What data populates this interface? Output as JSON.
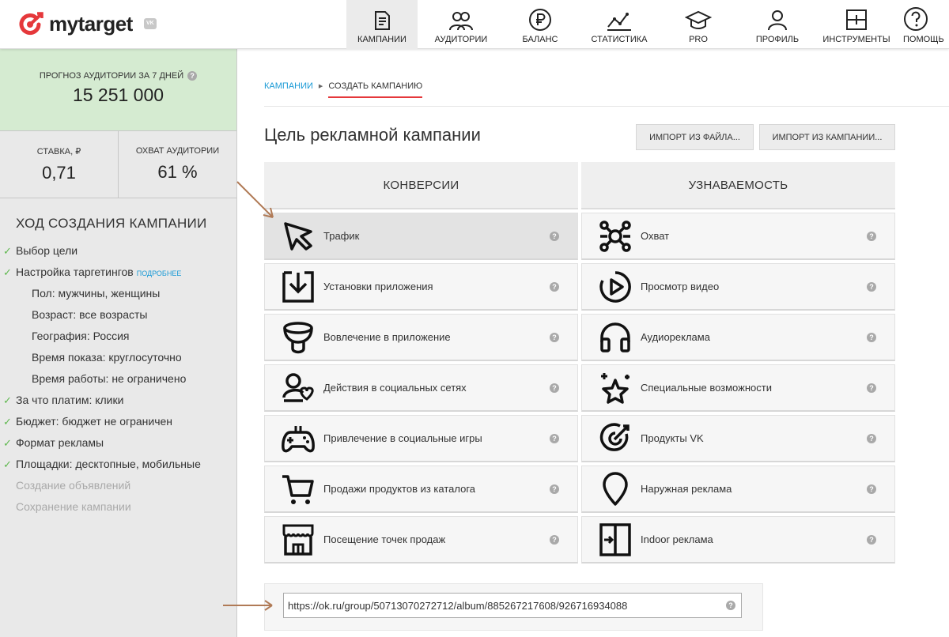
{
  "header": {
    "brand": "mytarget",
    "vk_badge": "VK",
    "nav": [
      {
        "label": "КАМПАНИИ",
        "icon": "campaigns-icon",
        "active": true
      },
      {
        "label": "АУДИТОРИИ",
        "icon": "audiences-icon"
      },
      {
        "label": "БАЛАНС",
        "icon": "ruble-icon"
      },
      {
        "label": "СТАТИСТИКА",
        "icon": "statistics-icon"
      },
      {
        "label": "PRO",
        "icon": "graduation-cap-icon"
      },
      {
        "label": "ПРОФИЛЬ",
        "icon": "profile-icon"
      },
      {
        "label": "ИНСТРУМЕНТЫ",
        "icon": "tools-icon"
      },
      {
        "label": "ПОМОЩЬ",
        "icon": "help-icon"
      }
    ]
  },
  "sidebar": {
    "forecast_label": "ПРОГНОЗ АУДИТОРИИ ЗА 7 ДНЕЙ",
    "forecast_value": "15 251 000",
    "rate_label": "СТАВКА, ₽",
    "rate_value": "0,71",
    "reach_label": "ОХВАТ АУДИТОРИИ",
    "reach_value": "61 %",
    "progress_title": "ХОД СОЗДАНИЯ КАМПАНИИ",
    "more_link": "ПОДРОБНЕЕ",
    "steps": [
      "Выбор цели",
      "Настройка таргетингов",
      "Пол: мужчины, женщины",
      "Возраст: все возрасты",
      "География: Россия",
      "Время показа: круглосуточно",
      "Время работы: не ограничено",
      "За что платим: клики",
      "Бюджет: бюджет не ограничен",
      "Формат рекламы",
      "Площадки: десктопные, мобильные",
      "Создание объявлений",
      "Сохранение кампании"
    ]
  },
  "main": {
    "breadcrumb": {
      "root": "КАМПАНИИ",
      "current": "СОЗДАТЬ КАМПАНИЮ"
    },
    "title": "Цель рекламной кампании",
    "import_file": "ИМПОРТ ИЗ ФАЙЛА...",
    "import_campaign": "ИМПОРТ ИЗ КАМПАНИИ...",
    "col_conversions": "КОНВЕРСИИ",
    "col_awareness": "УЗНАВАЕМОСТЬ",
    "conversions": [
      {
        "label": "Трафик",
        "icon": "cursor-icon",
        "selected": true
      },
      {
        "label": "Установки приложения",
        "icon": "app-install-icon"
      },
      {
        "label": "Вовлечение в приложение",
        "icon": "app-engagement-icon"
      },
      {
        "label": "Действия в социальных сетях",
        "icon": "social-actions-icon"
      },
      {
        "label": "Привлечение в социальные игры",
        "icon": "gamepad-icon"
      },
      {
        "label": "Продажи продуктов из каталога",
        "icon": "cart-icon"
      },
      {
        "label": "Посещение точек продаж",
        "icon": "store-icon"
      }
    ],
    "awareness": [
      {
        "label": "Охват",
        "icon": "reach-icon"
      },
      {
        "label": "Просмотр видео",
        "icon": "play-icon"
      },
      {
        "label": "Аудиореклама",
        "icon": "headphones-icon"
      },
      {
        "label": "Специальные возможности",
        "icon": "stars-icon"
      },
      {
        "label": "Продукты VK",
        "icon": "target-icon"
      },
      {
        "label": "Наружная реклама",
        "icon": "map-pin-icon"
      },
      {
        "label": "Indoor реклама",
        "icon": "door-enter-icon"
      }
    ],
    "url_value": "https://ok.ru/group/50713070272712/album/885267217608/926716934088",
    "help_glyph": "?"
  },
  "colors": {
    "accent": "#e5383b",
    "link": "#1a9ad6",
    "check": "#5fb84f",
    "forecast_bg": "#d5ebd1",
    "annotation_arrow": "#b07a56"
  }
}
